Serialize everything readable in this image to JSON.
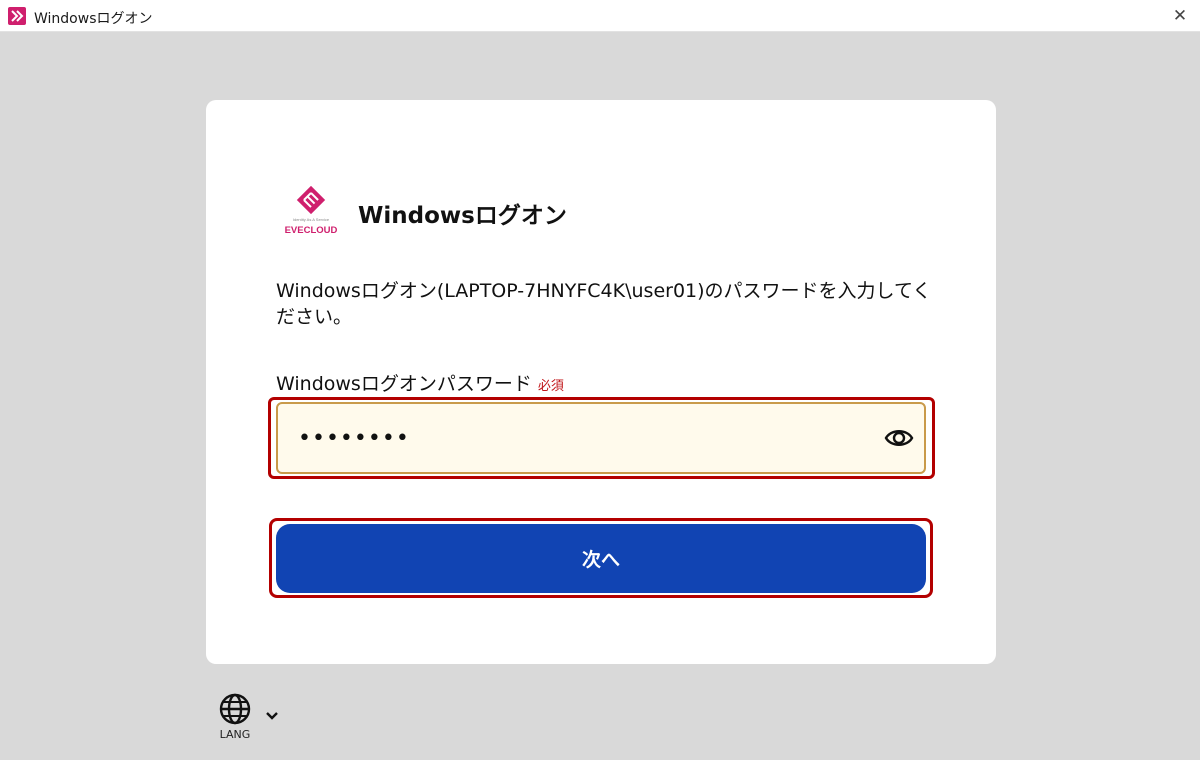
{
  "window": {
    "title": "Windowsログオン",
    "close_glyph": "✕"
  },
  "card": {
    "logo_text": "EVECLOUD",
    "logo_subtext": "Identity As A Service",
    "title": "Windowsログオン",
    "description": "Windowsログオン(LAPTOP-7HNYFC4K\\user01)のパスワードを入力してください。",
    "password_field": {
      "label": "Windowsログオンパスワード",
      "required_badge": "必須",
      "value": "••••••••"
    },
    "next_button": "次へ"
  },
  "language": {
    "label": "LANG"
  },
  "colors": {
    "brand": "#cf1f6d",
    "primary_button": "#1144b3",
    "highlight_outline": "#b30000",
    "required": "#c0161a"
  },
  "icons": [
    "app-logo-icon",
    "close-icon",
    "eye-icon",
    "globe-icon",
    "chevron-down-icon"
  ]
}
